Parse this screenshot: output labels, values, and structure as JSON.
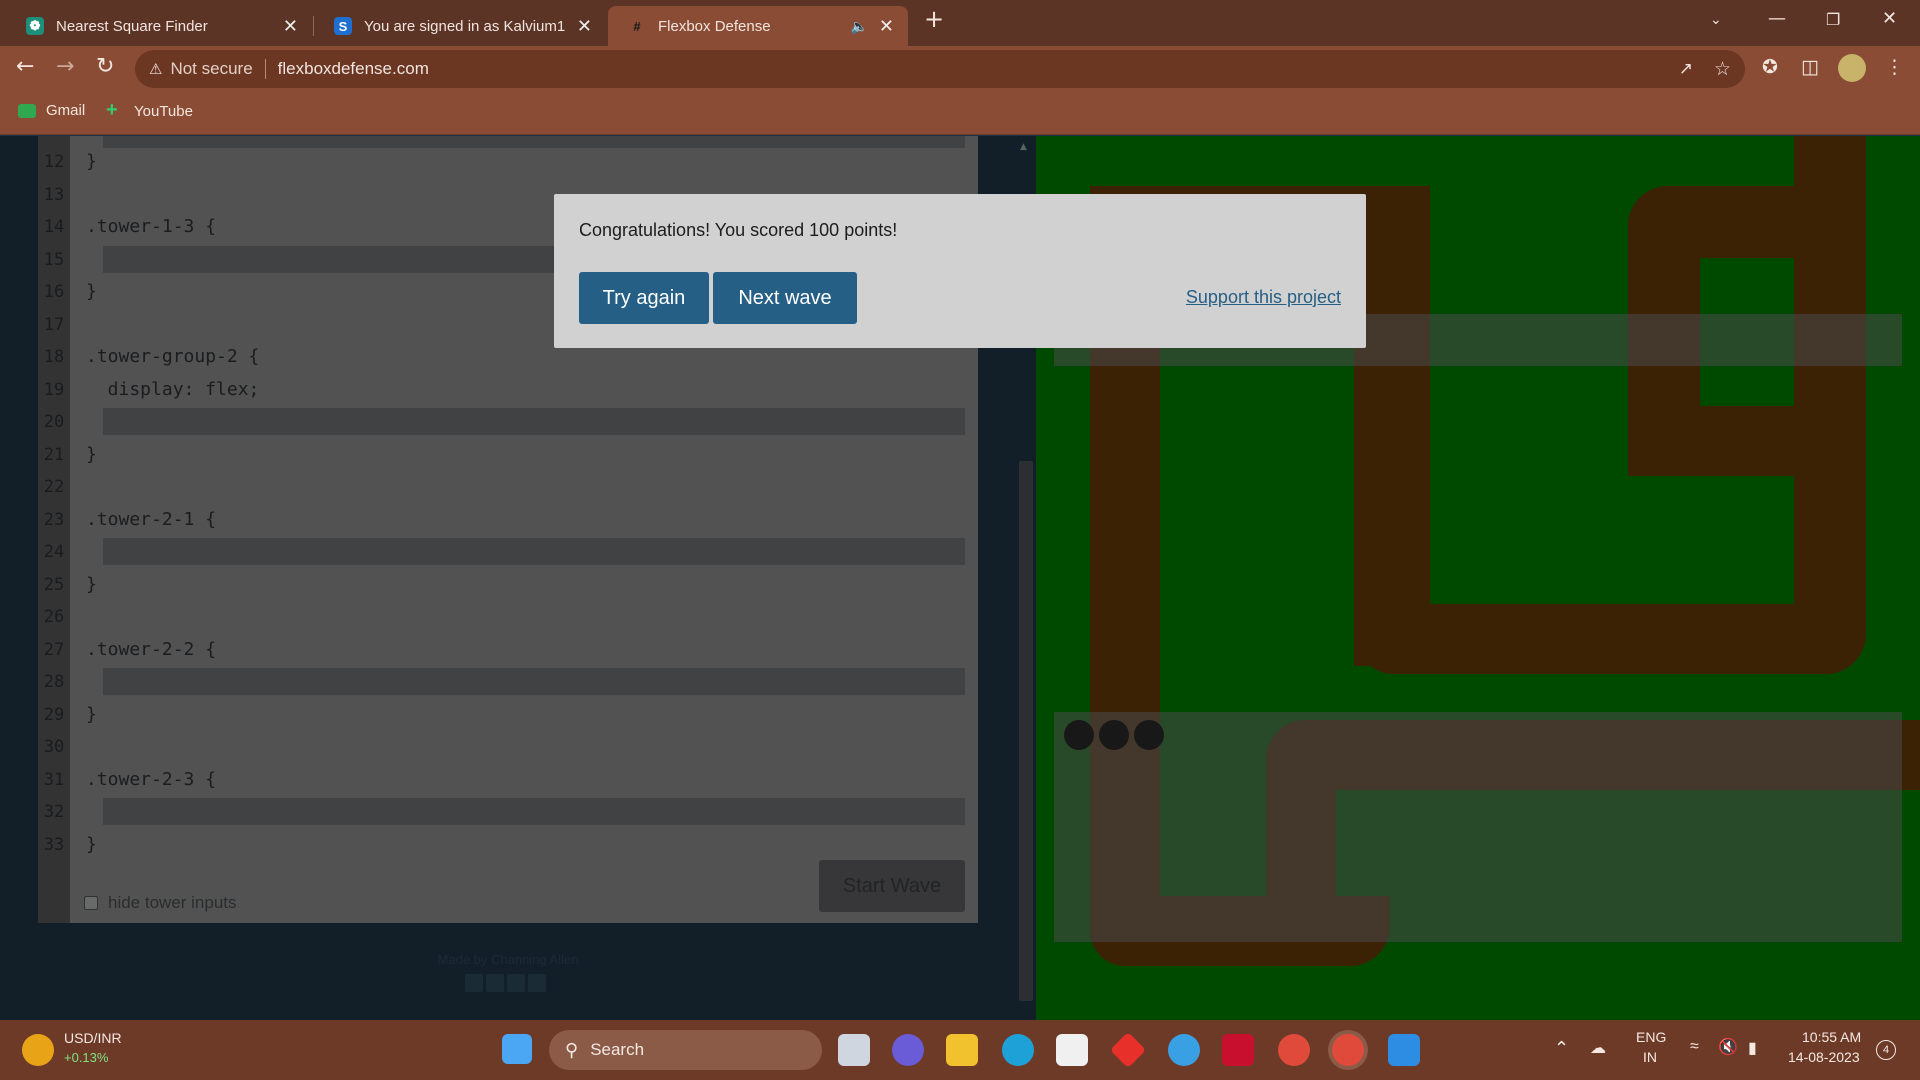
{
  "browser": {
    "tabs": [
      {
        "title": "Nearest Square Finder",
        "icon": "chatgpt-icon"
      },
      {
        "title": "You are signed in as Kalvium1",
        "icon": "s-logo-icon"
      },
      {
        "title": "Flexbox Defense",
        "icon": "hash-icon",
        "active": true
      }
    ],
    "security_label": "Not secure",
    "url": "flexboxdefense.com",
    "bookmarks": [
      {
        "label": "Gmail",
        "icon": "gmail-icon"
      },
      {
        "label": "YouTube",
        "icon": "youtube-icon"
      }
    ]
  },
  "editor": {
    "lines": [
      {
        "n": "12",
        "text": "}"
      },
      {
        "n": "13",
        "text": ""
      },
      {
        "n": "14",
        "text": ".tower-1-3 {"
      },
      {
        "n": "15",
        "text": ""
      },
      {
        "n": "16",
        "text": "}"
      },
      {
        "n": "17",
        "text": ""
      },
      {
        "n": "18",
        "text": ".tower-group-2 {"
      },
      {
        "n": "19",
        "text": "  display: flex;"
      },
      {
        "n": "20",
        "text": ""
      },
      {
        "n": "21",
        "text": "}"
      },
      {
        "n": "22",
        "text": ""
      },
      {
        "n": "23",
        "text": ".tower-2-1 {"
      },
      {
        "n": "24",
        "text": ""
      },
      {
        "n": "25",
        "text": "}"
      },
      {
        "n": "26",
        "text": ""
      },
      {
        "n": "27",
        "text": ".tower-2-2 {"
      },
      {
        "n": "28",
        "text": ""
      },
      {
        "n": "29",
        "text": "}"
      },
      {
        "n": "30",
        "text": ""
      },
      {
        "n": "31",
        "text": ".tower-2-3 {"
      },
      {
        "n": "32",
        "text": ""
      },
      {
        "n": "33",
        "text": "}"
      }
    ],
    "start_wave": "Start Wave",
    "hide_inputs_label": "hide tower inputs",
    "credit": "Made by Channing Allen"
  },
  "modal": {
    "message": "Congratulations! You scored 100 points!",
    "try_again": "Try again",
    "next_wave": "Next wave",
    "support": "Support this project"
  },
  "taskbar": {
    "ticker_name": "USD/INR",
    "ticker_change": "+0.13%",
    "search_placeholder": "Search",
    "lang_top": "ENG",
    "lang_bottom": "IN",
    "time": "10:55 AM",
    "date": "14-08-2023",
    "notification_count": "4"
  },
  "colors": {
    "board_green": "#008000",
    "path_brown": "#683b09",
    "button_blue": "#265f86",
    "chrome_brown": "#8a4c34"
  }
}
